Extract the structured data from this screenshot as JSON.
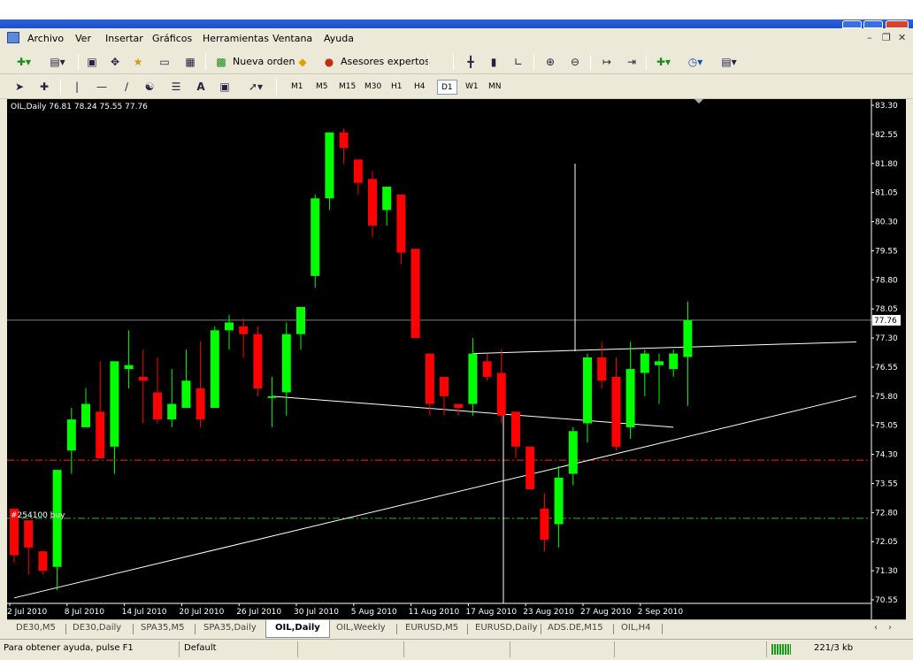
{
  "app": {
    "title": "",
    "menus": [
      "Archivo",
      "Ver",
      "Insertar",
      "Gráficos",
      "Herramientas",
      "Ventana",
      "Ayuda"
    ]
  },
  "toolbar": {
    "new_order": "Nueva orden",
    "expert_advisors": "Asesores expertos",
    "timeframes": [
      "M1",
      "M5",
      "M15",
      "M30",
      "H1",
      "H4",
      "D1",
      "W1",
      "MN"
    ],
    "active_timeframe": "D1"
  },
  "chart_header": "OIL,Daily  76.81 78.24 75.55 77.76",
  "order_label": "#254100   buy",
  "current_price_label": "77.76",
  "chart_data": {
    "type": "candlestick",
    "symbol": "OIL",
    "timeframe": "Daily",
    "ylim": [
      70.55,
      83.3
    ],
    "yticks": [
      "83.30",
      "82.55",
      "81.80",
      "81.05",
      "80.30",
      "79.55",
      "78.80",
      "78.05",
      "77.30",
      "76.55",
      "75.80",
      "75.05",
      "74.30",
      "73.55",
      "72.80",
      "72.05",
      "71.30",
      "70.55"
    ],
    "xtick_labels": [
      "2 Jul 2010",
      "8 Jul 2010",
      "14 Jul 2010",
      "20 Jul 2010",
      "26 Jul 2010",
      "30 Jul 2010",
      "5 Aug 2010",
      "11 Aug 2010",
      "17 Aug 2010",
      "23 Aug 2010",
      "27 Aug 2010",
      "2 Sep 2010"
    ],
    "candles": [
      {
        "open": 72.9,
        "high": 72.9,
        "low": 71.5,
        "close": 71.7
      },
      {
        "open": 72.6,
        "high": 72.6,
        "low": 71.2,
        "close": 71.9
      },
      {
        "open": 71.8,
        "high": 71.8,
        "low": 71.2,
        "close": 71.3
      },
      {
        "open": 71.4,
        "high": 73.6,
        "low": 70.8,
        "close": 73.9
      },
      {
        "open": 74.4,
        "high": 75.5,
        "low": 73.8,
        "close": 75.2
      },
      {
        "open": 75.0,
        "high": 76.0,
        "low": 75.0,
        "close": 75.6
      },
      {
        "open": 75.4,
        "high": 76.7,
        "low": 74.2,
        "close": 74.2
      },
      {
        "open": 74.5,
        "high": 76.7,
        "low": 73.8,
        "close": 76.7
      },
      {
        "open": 76.5,
        "high": 77.5,
        "low": 76.0,
        "close": 76.6
      },
      {
        "open": 76.3,
        "high": 77.0,
        "low": 75.1,
        "close": 76.2
      },
      {
        "open": 75.9,
        "high": 76.8,
        "low": 75.1,
        "close": 75.2
      },
      {
        "open": 75.2,
        "high": 76.5,
        "low": 75.0,
        "close": 75.6
      },
      {
        "open": 75.5,
        "high": 77.0,
        "low": 75.5,
        "close": 76.2
      },
      {
        "open": 76.0,
        "high": 77.2,
        "low": 75.0,
        "close": 75.2
      },
      {
        "open": 75.5,
        "high": 77.6,
        "low": 75.5,
        "close": 77.5
      },
      {
        "open": 77.5,
        "high": 77.9,
        "low": 77.0,
        "close": 77.7
      },
      {
        "open": 77.6,
        "high": 77.8,
        "low": 76.8,
        "close": 77.4
      },
      {
        "open": 77.4,
        "high": 77.6,
        "low": 75.8,
        "close": 76.0
      },
      {
        "open": 75.8,
        "high": 76.3,
        "low": 75.0,
        "close": 75.8
      },
      {
        "open": 75.9,
        "high": 77.7,
        "low": 75.3,
        "close": 77.4
      },
      {
        "open": 77.4,
        "high": 78.0,
        "low": 77.0,
        "close": 78.1
      },
      {
        "open": 78.9,
        "high": 81.0,
        "low": 78.6,
        "close": 80.9
      },
      {
        "open": 80.9,
        "high": 82.6,
        "low": 80.6,
        "close": 82.6
      },
      {
        "open": 82.6,
        "high": 82.7,
        "low": 81.8,
        "close": 82.2
      },
      {
        "open": 81.9,
        "high": 81.9,
        "low": 81.0,
        "close": 81.3
      },
      {
        "open": 81.4,
        "high": 81.6,
        "low": 79.9,
        "close": 80.2
      },
      {
        "open": 80.6,
        "high": 81.2,
        "low": 80.2,
        "close": 81.2
      },
      {
        "open": 81.0,
        "high": 81.0,
        "low": 79.2,
        "close": 79.5
      },
      {
        "open": 79.6,
        "high": 79.6,
        "low": 77.3,
        "close": 77.3
      },
      {
        "open": 76.9,
        "high": 76.9,
        "low": 75.3,
        "close": 75.6
      },
      {
        "open": 76.3,
        "high": 76.3,
        "low": 75.3,
        "close": 75.8
      },
      {
        "open": 75.6,
        "high": 75.6,
        "low": 75.3,
        "close": 75.5
      },
      {
        "open": 75.6,
        "high": 77.3,
        "low": 75.3,
        "close": 76.9
      },
      {
        "open": 76.7,
        "high": 76.9,
        "low": 76.2,
        "close": 76.3
      },
      {
        "open": 76.4,
        "high": 77.0,
        "low": 75.1,
        "close": 75.3
      },
      {
        "open": 75.4,
        "high": 75.4,
        "low": 74.2,
        "close": 74.5
      },
      {
        "open": 74.5,
        "high": 74.5,
        "low": 73.5,
        "close": 73.4
      },
      {
        "open": 72.9,
        "high": 73.3,
        "low": 71.8,
        "close": 72.1
      },
      {
        "open": 72.5,
        "high": 74.0,
        "low": 71.9,
        "close": 73.7
      },
      {
        "open": 73.8,
        "high": 75.0,
        "low": 73.5,
        "close": 74.9
      },
      {
        "open": 75.1,
        "high": 76.9,
        "low": 74.6,
        "close": 76.8
      },
      {
        "open": 76.8,
        "high": 77.2,
        "low": 76.0,
        "close": 76.2
      },
      {
        "open": 76.3,
        "high": 76.8,
        "low": 74.4,
        "close": 74.5
      },
      {
        "open": 75.0,
        "high": 77.2,
        "low": 74.7,
        "close": 76.5
      },
      {
        "open": 76.4,
        "high": 77.0,
        "low": 75.8,
        "close": 76.9
      },
      {
        "open": 76.6,
        "high": 76.9,
        "low": 75.6,
        "close": 76.7
      },
      {
        "open": 76.5,
        "high": 77.0,
        "low": 76.3,
        "close": 76.9
      },
      {
        "open": 76.81,
        "high": 78.24,
        "low": 75.55,
        "close": 77.76
      }
    ],
    "horizontal_lines": [
      {
        "price": 77.76,
        "color": "#808080",
        "style": "solid"
      },
      {
        "price": 74.15,
        "color": "#ff2020",
        "style": "dashdot"
      },
      {
        "price": 72.65,
        "color": "#20c020",
        "style": "dashdot"
      }
    ],
    "trendlines": [
      {
        "from": [
          0,
          70.6
        ],
        "to": [
          "right",
          75.8
        ]
      },
      {
        "from": [
          18,
          75.8
        ],
        "to": [
          46,
          75.0
        ]
      },
      {
        "from": [
          32,
          76.9
        ],
        "to": [
          "right",
          77.2
        ]
      }
    ],
    "colors": {
      "bull": "#00ff00",
      "bear": "#ff0000",
      "background": "#000000",
      "axis_text": "#ffffff",
      "grid": "#ffffff"
    }
  },
  "tabs": [
    "DE30,M5",
    "DE30,Daily",
    "SPA35,M5",
    "SPA35,Daily",
    "OIL,Daily",
    "OIL,Weekly",
    "EURUSD,M5",
    "EURUSD,Daily",
    "ADS.DE,M15",
    "OIL,H4"
  ],
  "active_tab": "OIL,Daily",
  "status": {
    "help": "Para obtener ayuda, pulse F1",
    "profile": "Default",
    "traffic": "221/3 kb"
  }
}
